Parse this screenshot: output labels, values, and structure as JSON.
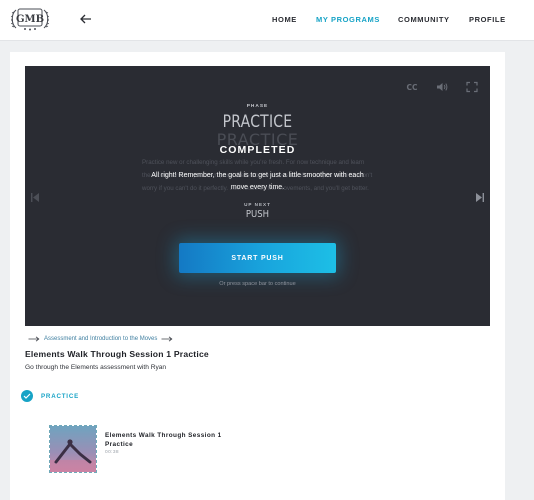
{
  "header": {
    "logo": {
      "text": "GMB",
      "icon": "gmb-crest-logo"
    },
    "back_icon": "arrow-left-icon",
    "nav": [
      {
        "label": "HOME",
        "active": false
      },
      {
        "label": "MY PROGRAMS",
        "active": true
      },
      {
        "label": "COMMUNITY",
        "active": false
      },
      {
        "label": "PROFILE",
        "active": false
      }
    ]
  },
  "player": {
    "controls": [
      "closed-captions-icon",
      "volume-icon",
      "fullscreen-icon"
    ],
    "background_title": "PRACTICE",
    "background_text": "Practice new or challenging skills while you're fresh. For now technique and learn the movements at your own pace. Refer to the videos as often as you need to. Don't worry if you can't do it perfectly. Just focus on the movements, and you'll get better.",
    "phase_label": "PHASE",
    "phase_title": "PRACTICE",
    "completed_label": "COMPLETED",
    "message": "All right! Remember, the goal is to get just a little smoother with each move every time.",
    "up_next_label": "UP NEXT",
    "up_next_title": "PUSH",
    "start_button": "START PUSH",
    "hint": "Or press space bar to continue",
    "prev_icon": "skip-previous-icon",
    "next_icon": "skip-next-icon"
  },
  "lesson": {
    "breadcrumb": "Assessment and Introduction to the Moves",
    "title": "Elements Walk Through Session 1 Practice",
    "subtitle": "Go through the Elements assessment with Ryan",
    "section_label": "PRACTICE",
    "section_completed": true,
    "items": [
      {
        "title": "Elements Walk Through Session 1 Practice",
        "duration": "00:38"
      }
    ]
  },
  "colors": {
    "accent": "#17a3c6",
    "player_bg": "#2a2c33",
    "button_start": "#1479c4",
    "button_end": "#1dbfe6"
  }
}
